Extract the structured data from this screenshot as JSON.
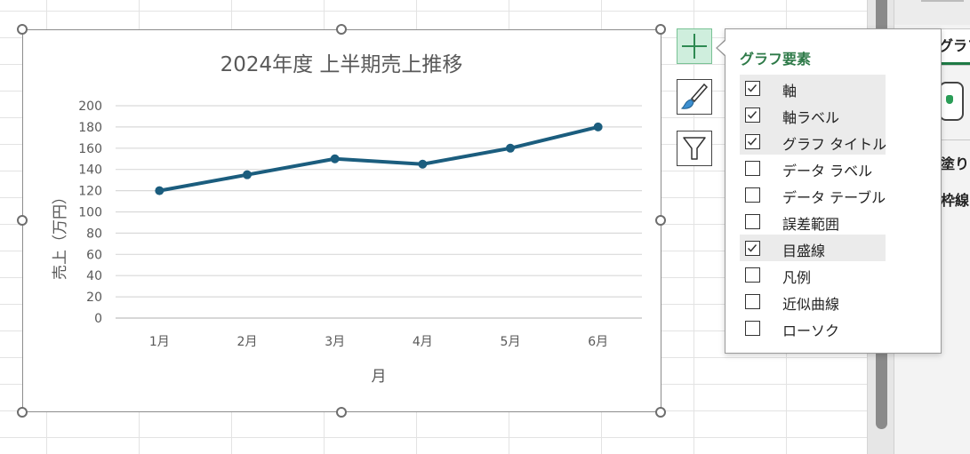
{
  "chart_data": {
    "type": "line",
    "title": "2024年度 上半期売上推移",
    "xlabel": "月",
    "ylabel": "売上（万円）",
    "categories": [
      "1月",
      "2月",
      "3月",
      "4月",
      "5月",
      "6月"
    ],
    "series": [
      {
        "values": [
          120,
          135,
          150,
          145,
          160,
          180
        ]
      }
    ],
    "ylim": [
      0,
      200
    ],
    "yticks": [
      0,
      20,
      40,
      60,
      80,
      100,
      120,
      140,
      160,
      180,
      200
    ],
    "grid": true,
    "legend": "none",
    "line_color": "#1b5d7e"
  },
  "chart_buttons": {
    "elements_icon": "plus-icon",
    "styles_icon": "brush-icon",
    "filter_icon": "funnel-icon"
  },
  "flyout": {
    "title": "グラフ要素",
    "items": [
      {
        "label": "軸",
        "checked": true
      },
      {
        "label": "軸ラベル",
        "checked": true
      },
      {
        "label": "グラフ タイトル",
        "checked": true
      },
      {
        "label": "データ ラベル",
        "checked": false
      },
      {
        "label": "データ テーブル",
        "checked": false
      },
      {
        "label": "誤差範囲",
        "checked": false
      },
      {
        "label": "目盛線",
        "checked": true
      },
      {
        "label": "凡例",
        "checked": false
      },
      {
        "label": "近似曲線",
        "checked": false
      },
      {
        "label": "ローソク",
        "checked": false
      }
    ]
  },
  "side_pane": {
    "tab_label": "グラフ",
    "fill_label": "塗り",
    "border_label": "枠線"
  },
  "colors": {
    "accent": "#2e7a48",
    "plus_bg": "#cfeedd"
  }
}
